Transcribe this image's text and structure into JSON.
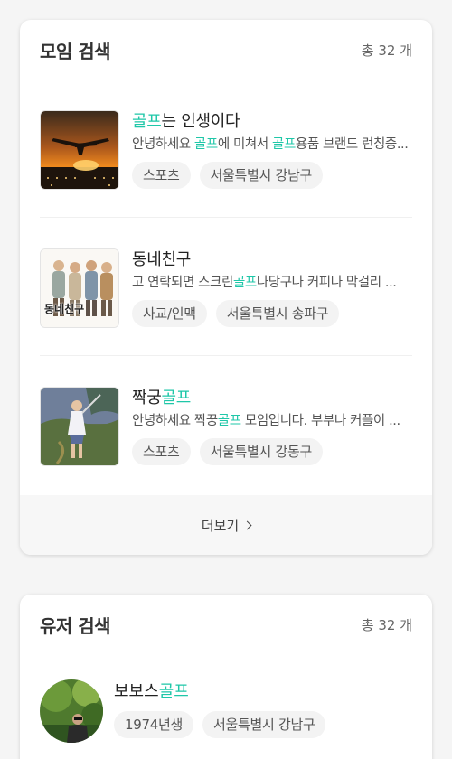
{
  "moim_section": {
    "title": "모임 검색",
    "count": "총 32 개",
    "items": [
      {
        "title_hl": "골프",
        "title_rest": "는 인생이다",
        "desc_parts": [
          "안녕하세요 ",
          "골프",
          "에 미쳐서 ",
          "골프",
          "용품 브랜드 런칭중..."
        ],
        "tags": [
          "스포츠",
          "서울특별시 강남구"
        ],
        "image": "airplane-sunset"
      },
      {
        "title_plain": "동네친구",
        "desc_parts": [
          "고 연락되면 스크린",
          "골프",
          "나당구나 커피나 막걸리 ..."
        ],
        "tags": [
          "사교/인맥",
          "서울특별시 송파구"
        ],
        "image": "neighborhood-friends",
        "image_caption": "동네친구"
      },
      {
        "title_plain": "짝궁",
        "title_hl": "골프",
        "desc_parts": [
          "안녕하세요 짝꿍",
          "골프",
          " 모임입니다. 부부나 커플이 ..."
        ],
        "tags": [
          "스포츠",
          "서울특별시 강동구"
        ],
        "image": "golfer-painting"
      }
    ],
    "more_label": "더보기"
  },
  "user_section": {
    "title": "유저 검색",
    "count": "총 32 개",
    "users": [
      {
        "name_plain": "보보스",
        "name_hl": "골프",
        "tags": [
          "1974년생",
          "서울특별시 강남구"
        ],
        "avatar": "outdoor-portrait"
      }
    ]
  },
  "colors": {
    "highlight": "#1fc7a8",
    "card_bg": "#ffffff",
    "page_bg": "#f5f5f5",
    "tag_bg": "#f3f3f3"
  }
}
